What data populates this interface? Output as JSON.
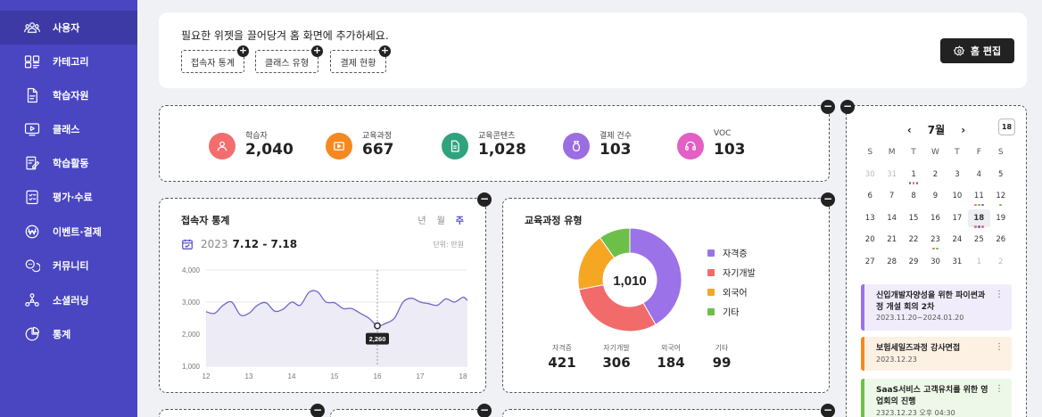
{
  "sidebar": {
    "items": [
      {
        "label": "사용자",
        "icon": "users-icon"
      },
      {
        "label": "카테고리",
        "icon": "category-icon"
      },
      {
        "label": "학습자원",
        "icon": "document-icon"
      },
      {
        "label": "클래스",
        "icon": "play-screen-icon"
      },
      {
        "label": "학습활동",
        "icon": "edit-note-icon"
      },
      {
        "label": "평가·수료",
        "icon": "checklist-icon"
      },
      {
        "label": "이벤트·결제",
        "icon": "won-coin-icon"
      },
      {
        "label": "커뮤니티",
        "icon": "chat-bubbles-icon"
      },
      {
        "label": "소셜러닝",
        "icon": "network-icon"
      },
      {
        "label": "통계",
        "icon": "pie-chart-icon"
      }
    ]
  },
  "widget_bar": {
    "guide": "필요한 위젯을 끌어당겨 홈 화면에 추가하세요.",
    "chips": [
      "접속자 통계",
      "클래스 유형",
      "결제 현황"
    ],
    "home_edit_label": "홈 편집"
  },
  "stats": [
    {
      "label": "학습자",
      "value": "2,040",
      "color": "#f26d6d"
    },
    {
      "label": "교육과정",
      "value": "667",
      "color": "#f5891f"
    },
    {
      "label": "교육콘텐츠",
      "value": "1,028",
      "color": "#2fa37e"
    },
    {
      "label": "결제 건수",
      "value": "103",
      "color": "#9a6ee0"
    },
    {
      "label": "VOC",
      "value": "103",
      "color": "#e35fc3"
    }
  ],
  "visitor_stats": {
    "title": "접속자 통계",
    "tabs": [
      "년",
      "월",
      "주"
    ],
    "selected_tab": "주",
    "year": "2023",
    "range": "7.12 - 7.18",
    "unit": "단위: 만원",
    "tooltip": "2,260"
  },
  "chart_data": [
    {
      "type": "area",
      "title": "접속자 통계",
      "x_ticks": [
        "12",
        "13",
        "14",
        "15",
        "16",
        "17",
        "18"
      ],
      "y_ticks": [
        "4,000",
        "3,000",
        "2,000",
        "1,000"
      ],
      "ylim": [
        1000,
        4000
      ],
      "x": [
        12.0,
        12.2,
        12.4,
        12.6,
        12.8,
        13.0,
        13.2,
        13.4,
        13.6,
        13.8,
        14.0,
        14.2,
        14.4,
        14.6,
        14.8,
        15.0,
        15.2,
        15.4,
        15.6,
        15.8,
        16.0,
        16.2,
        16.4,
        16.6,
        16.8,
        17.0,
        17.2,
        17.4,
        17.6,
        17.8,
        18.0,
        18.1
      ],
      "values": [
        2700,
        2650,
        2900,
        3000,
        2600,
        2650,
        2900,
        2980,
        2720,
        2780,
        3000,
        2900,
        3300,
        3320,
        3000,
        2980,
        2800,
        2800,
        2650,
        2500,
        2260,
        2340,
        2500,
        3000,
        3120,
        3000,
        2950,
        2900,
        3100,
        3000,
        3150,
        3050
      ],
      "highlight": {
        "x": 16,
        "y": 2260,
        "label": "2,260"
      },
      "grid": true
    },
    {
      "type": "pie",
      "title": "교육과정 유형",
      "center_label": "1,010",
      "series": [
        {
          "name": "자격증",
          "value": 421,
          "display": "421",
          "color": "#9c72e8"
        },
        {
          "name": "자기개발",
          "value": 306,
          "display": "306",
          "color": "#f26b6b"
        },
        {
          "name": "외국어",
          "value": 184,
          "display": "184",
          "color": "#f5a623"
        },
        {
          "name": "기타",
          "value": 99,
          "display": "99",
          "color": "#6cc04a"
        }
      ]
    }
  ],
  "calendar": {
    "month": "7월",
    "today_btn": "18",
    "dow": [
      "S",
      "M",
      "T",
      "W",
      "T",
      "F",
      "S"
    ],
    "weeks": [
      [
        "30",
        "31",
        "1",
        "2",
        "3",
        "4",
        "5"
      ],
      [
        "6",
        "7",
        "8",
        "9",
        "10",
        "11",
        "12"
      ],
      [
        "13",
        "14",
        "15",
        "16",
        "17",
        "18",
        "19"
      ],
      [
        "20",
        "21",
        "22",
        "23",
        "24",
        "25",
        "26"
      ],
      [
        "27",
        "28",
        "29",
        "30",
        "31",
        "1",
        "2"
      ]
    ],
    "events": [
      {
        "title": "신입개발자양성을 위한 파이썬과정 개설 회의 2차",
        "date": "2023.11.20~2024.01.20",
        "bar": "#9c72e8",
        "bg": "#f1ecfb"
      },
      {
        "title": "보험세일즈과정 강사면접",
        "date": "2023.12.23",
        "bar": "#f5891f",
        "bg": "#fdf1e4"
      },
      {
        "title": "SaaS서비스 고객유치를 위한 영업회의 진행",
        "date": "2323.12.23 오후 04:30",
        "bar": "#6cc04a",
        "bg": "#eef8e8"
      }
    ]
  }
}
